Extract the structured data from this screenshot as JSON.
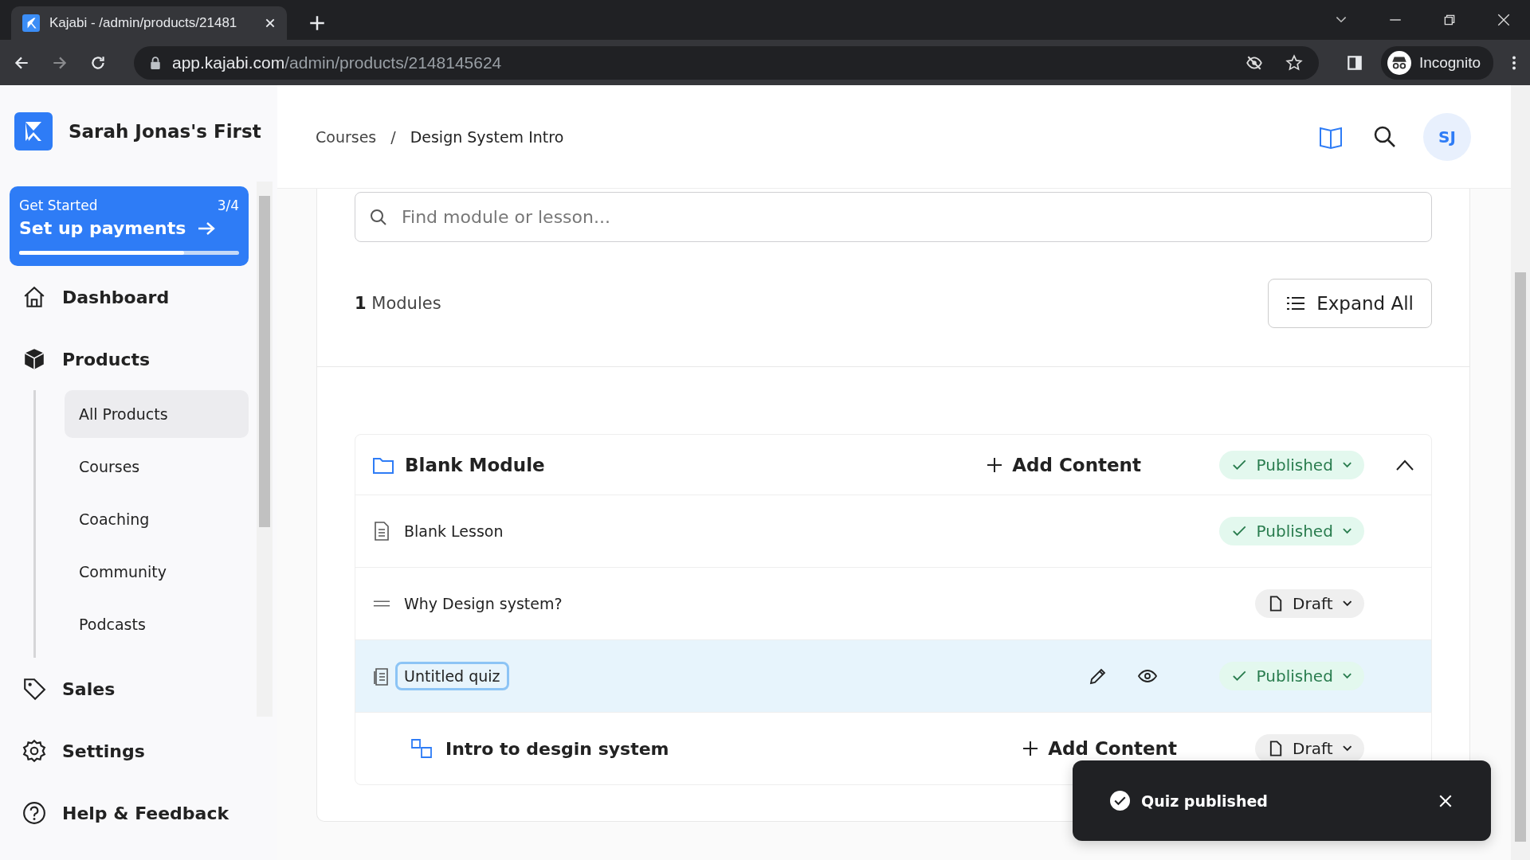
{
  "browser": {
    "tab_title": "Kajabi - /admin/products/21481",
    "url_host": "app.kajabi.com",
    "url_path": "/admin/products/2148145624",
    "profile": "Incognito"
  },
  "sidebar": {
    "brand": "Sarah Jonas's First",
    "get_started": {
      "label": "Get Started",
      "count": "3/4",
      "title": "Set up payments",
      "level": 0.75
    },
    "nav": [
      {
        "kind": "dashboard",
        "label": "Dashboard"
      },
      {
        "kind": "products",
        "label": "Products",
        "expanded": true,
        "children": [
          {
            "label": "All Products",
            "selected": true
          },
          {
            "label": "Courses",
            "selected": false
          },
          {
            "label": "Coaching",
            "selected": false
          },
          {
            "label": "Community",
            "selected": false
          },
          {
            "label": "Podcasts",
            "selected": false
          }
        ]
      },
      {
        "kind": "sales",
        "label": "Sales"
      },
      {
        "kind": "settings",
        "label": "Settings"
      },
      {
        "kind": "help",
        "label": "Help & Feedback"
      }
    ]
  },
  "header": {
    "breadcrumb": [
      "Courses",
      "Design System Intro"
    ],
    "separator": "/",
    "avatar": "SJ"
  },
  "search": {
    "placeholder": "Find module or lesson..."
  },
  "summary": {
    "count": "1",
    "label": "Modules",
    "expand_button": "Expand All"
  },
  "module": {
    "title": "Blank Module",
    "add_label": "Add Content",
    "status": {
      "label": "Published",
      "kind": "published"
    },
    "expanded": true,
    "items": [
      {
        "kind": "lesson",
        "title": "Blank Lesson",
        "selected": false,
        "status": {
          "label": "Published",
          "kind": "published"
        }
      },
      {
        "kind": "drag",
        "title": "Why Design system?",
        "selected": false,
        "status": {
          "label": "Draft",
          "kind": "draft"
        }
      },
      {
        "kind": "quiz",
        "title": "Untitled quiz",
        "selected": true,
        "status": {
          "label": "Published",
          "kind": "published"
        }
      },
      {
        "kind": "submodule",
        "title": "Intro to desgin system",
        "selected": false,
        "add_label": "Add Content",
        "status": {
          "label": "Draft",
          "kind": "draft"
        }
      }
    ]
  },
  "toast": {
    "message": "Quiz published"
  }
}
